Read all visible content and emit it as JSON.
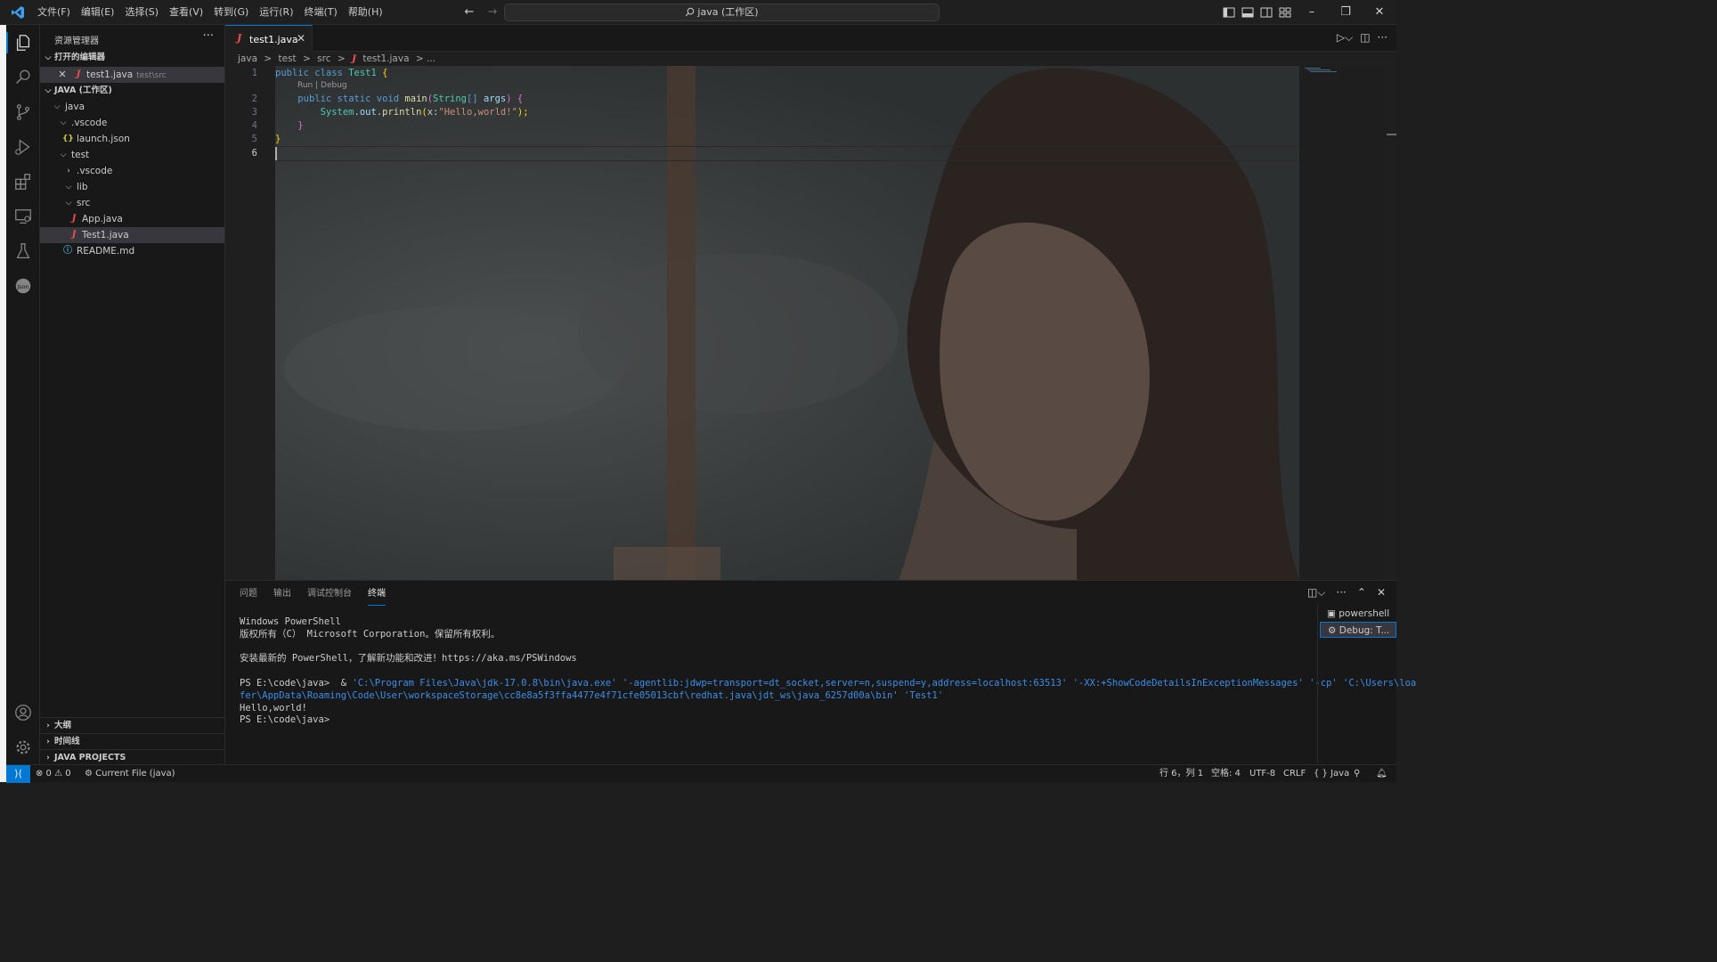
{
  "titlebar": {
    "menu": [
      "文件(F)",
      "编辑(E)",
      "选择(S)",
      "查看(V)",
      "转到(G)",
      "运行(R)",
      "终端(T)",
      "帮助(H)"
    ],
    "search": "java (工作区)"
  },
  "sidebar": {
    "title": "资源管理器",
    "more": "···",
    "open_editors": {
      "header": "打开的编辑器",
      "item_label": "test1.java",
      "item_desc": "test\\src"
    },
    "workspace": {
      "header": "JAVA (工作区)",
      "items": [
        {
          "label": "java"
        },
        {
          "label": ".vscode"
        },
        {
          "label": "launch.json"
        },
        {
          "label": "test"
        },
        {
          "label": ".vscode"
        },
        {
          "label": "lib"
        },
        {
          "label": "src"
        },
        {
          "label": "App.java"
        },
        {
          "label": "Test1.java"
        },
        {
          "label": "README.md"
        }
      ]
    },
    "outline": "大纲",
    "timeline": "时间线",
    "java_projects": "JAVA PROJECTS"
  },
  "editor": {
    "tab_label": "test1.java",
    "breadcrumb": [
      "java",
      ">",
      "test",
      ">",
      "src",
      ">",
      "test1.java",
      "> ..."
    ],
    "line_numbers": [
      "1",
      "2",
      "3",
      "4",
      "5",
      "6"
    ],
    "codelens": "Run | Debug",
    "code": {
      "l1_kw": "public class",
      "l1_cls": "Test1",
      "l1_br": "{",
      "l2_kw": "public static void",
      "l2_fn": "main",
      "l2_p": "(",
      "l2_type": "String",
      "l2_arr": "[]",
      "l2_var": "args",
      "l2_p2": ")",
      "l2_br": "{",
      "l3_cls": "System",
      "l3_dot1": ".",
      "l3_var": "out",
      "l3_dot2": ".",
      "l3_fn": "println",
      "l3_p": "(",
      "l3_hint": "x:",
      "l3_str": "\"Hello,world!\"",
      "l3_end": ");",
      "l4_br": "}",
      "l5_br": "}"
    }
  },
  "panel": {
    "tabs": [
      "问题",
      "输出",
      "调试控制台",
      "终端"
    ],
    "terminal": {
      "lines": [
        "Windows PowerShell",
        "版权所有（C） Microsoft Corporation。保留所有权利。",
        "",
        "安装最新的 PowerShell，了解新功能和改进！https://aka.ms/PSWindows",
        ""
      ],
      "cmd_prompt": "PS E:\\code\\java>  & ",
      "cmd_args_1": "'C:\\Program Files\\Java\\jdk-17.0.8\\bin\\java.exe' '-agentlib:jdwp=transport=dt_socket,server=n,suspend=y,address=localhost:63513' '-XX:+ShowCodeDetailsInExceptionMessages' '-cp' 'C:\\Users\\loa",
      "cmd_args_2": "fer\\AppData\\Roaming\\Code\\User\\workspaceStorage\\cc8e8a5f3ffa4477e4f71cfe05013cbf\\redhat.java\\jdt_ws\\java_6257d00a\\bin' 'Test1'",
      "output": "Hello,world!",
      "prompt": "PS E:\\code\\java>"
    },
    "terminal_list": [
      "powershell",
      "Debug: T..."
    ]
  },
  "statusbar": {
    "problems": "⊗ 0 ⚠ 0",
    "launch": "Current File (java)",
    "position": "行 6，列 1",
    "spaces": "空格: 4",
    "encoding": "UTF-8",
    "eol": "CRLF",
    "language": "{ } Java"
  }
}
